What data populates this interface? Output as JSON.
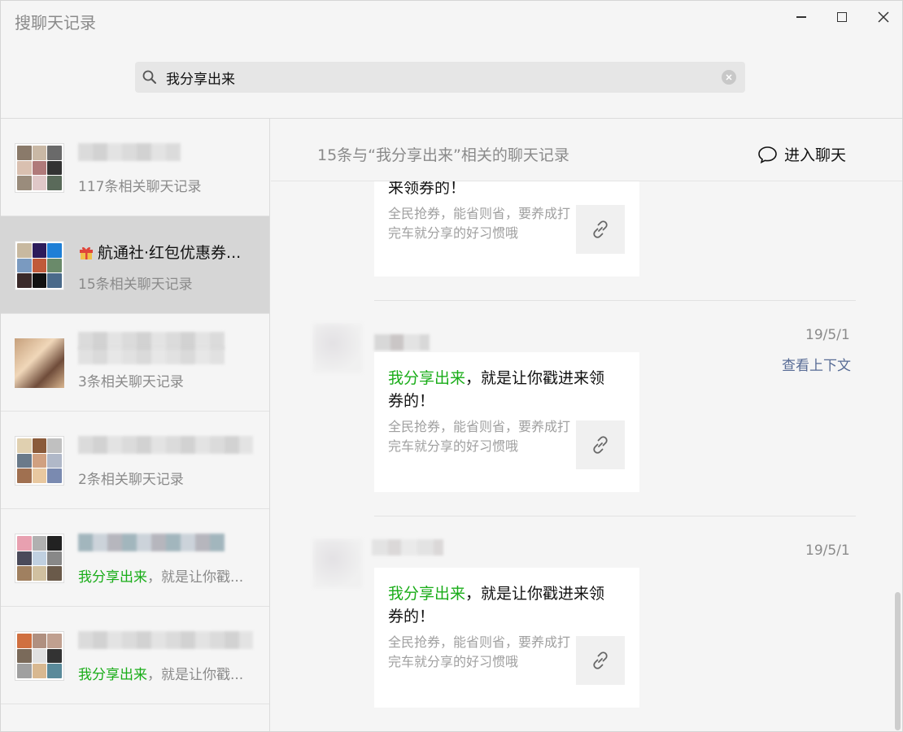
{
  "window": {
    "title": "搜聊天记录"
  },
  "search": {
    "value": "我分享出来",
    "placeholder": ""
  },
  "conversations": [
    {
      "name": "",
      "count_text": "117条相关聊天记录",
      "snippet_highlight": "",
      "snippet_rest": ""
    },
    {
      "name": "航通社·红包优惠券...",
      "count_text": "15条相关聊天记录",
      "snippet_highlight": "",
      "snippet_rest": ""
    },
    {
      "name": "",
      "count_text": "3条相关聊天记录",
      "snippet_highlight": "",
      "snippet_rest": ""
    },
    {
      "name": "",
      "count_text": "2条相关聊天记录",
      "snippet_highlight": "",
      "snippet_rest": ""
    },
    {
      "name": "",
      "count_text": "",
      "snippet_highlight": "我分享出来",
      "snippet_rest": "，就是让你戳..."
    },
    {
      "name": "",
      "count_text": "",
      "snippet_highlight": "我分享出来",
      "snippet_rest": "，就是让你戳..."
    }
  ],
  "main": {
    "result_count": "15条与“我分享出来”相关的聊天记录",
    "enter_chat": "进入聊天",
    "context_link": "查看上下文",
    "messages": [
      {
        "date": "",
        "title_highlight": "",
        "title_rest": "来领券的！",
        "desc": "全民抢券，能省则省，要养成打完车就分享的好习惯哦"
      },
      {
        "date": "19/5/1",
        "title_highlight": "我分享出来",
        "title_rest": "，就是让你戳进来领券的！",
        "desc": "全民抢券，能省则省，要养成打完车就分享的好习惯哦"
      },
      {
        "date": "19/5/1",
        "title_highlight": "我分享出来",
        "title_rest": "，就是让你戳进来领券的！",
        "desc": "全民抢券，能省则省，要养成打完车就分享的好习惯哦"
      }
    ]
  },
  "colors": {
    "highlight": "#1aad19",
    "link": "#576b95",
    "selected_row": "#d6d6d6"
  }
}
